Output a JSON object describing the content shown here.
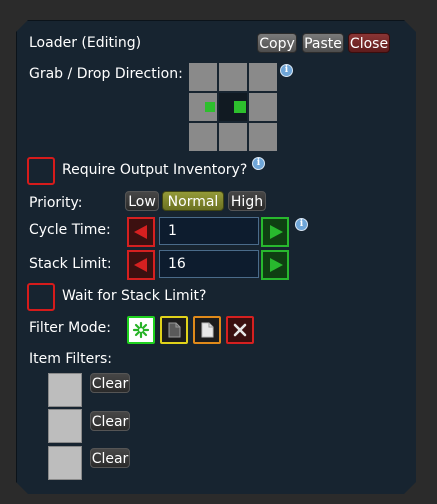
{
  "window": {
    "title": "Loader (Editing)",
    "copy_label": "Copy",
    "paste_label": "Paste",
    "close_label": "Close"
  },
  "direction": {
    "label": "Grab / Drop Direction:",
    "info_glyph": "i"
  },
  "require_output": {
    "label": "Require Output Inventory?",
    "checked": false,
    "info_glyph": "i"
  },
  "priority": {
    "label": "Priority:",
    "options": [
      "Low",
      "Normal",
      "High"
    ],
    "selected": "Normal"
  },
  "cycle_time": {
    "label": "Cycle Time:",
    "value": "1",
    "info_glyph": "i"
  },
  "stack_limit": {
    "label": "Stack Limit:",
    "value": "16"
  },
  "wait_stack": {
    "label": "Wait for Stack Limit?",
    "checked": false
  },
  "filter_mode": {
    "label": "Filter Mode:",
    "modes": [
      "whitelist-icon",
      "blacklist-icon",
      "document-icon",
      "clear-filter-icon"
    ]
  },
  "item_filters": {
    "label": "Item Filters:",
    "slots": [
      {
        "clear_label": "Clear"
      },
      {
        "clear_label": "Clear"
      },
      {
        "clear_label": "Clear"
      }
    ]
  },
  "colors": {
    "panel_bg": "#172430",
    "accent_green": "#28b82e",
    "accent_red": "#d62020",
    "selected_option": "#8a9030"
  }
}
